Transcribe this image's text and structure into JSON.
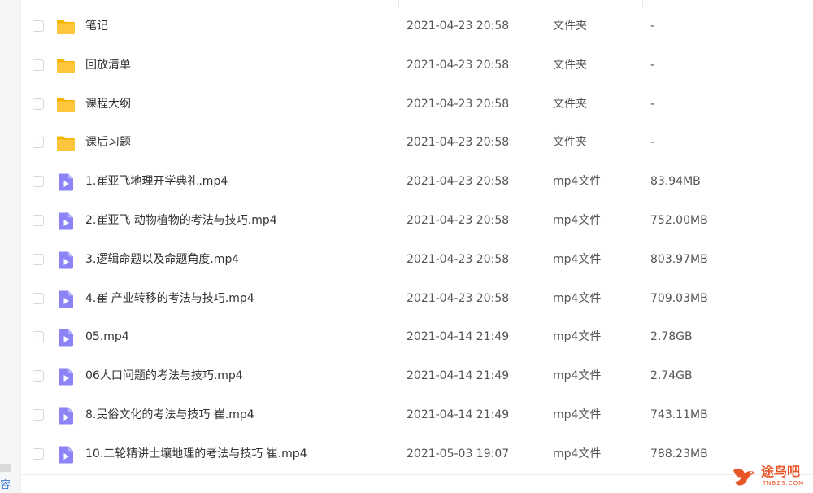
{
  "colors": {
    "folder": "#FFC53D",
    "folder_tab": "#F5B400",
    "video": "#8B83F6",
    "accent": "#3B7BD6",
    "watermark": "#E8572A"
  },
  "left_strip": {
    "text": "容"
  },
  "files": [
    {
      "name": "笔记",
      "date": "2021-04-23 20:58",
      "type": "文件夹",
      "size": "-",
      "icon": "folder-icon"
    },
    {
      "name": "回放清单",
      "date": "2021-04-23 20:58",
      "type": "文件夹",
      "size": "-",
      "icon": "folder-icon"
    },
    {
      "name": "课程大纲",
      "date": "2021-04-23 20:58",
      "type": "文件夹",
      "size": "-",
      "icon": "folder-icon"
    },
    {
      "name": "课后习题",
      "date": "2021-04-23 20:58",
      "type": "文件夹",
      "size": "-",
      "icon": "folder-icon"
    },
    {
      "name": "1.崔亚飞地理开学典礼.mp4",
      "date": "2021-04-23 20:58",
      "type": "mp4文件",
      "size": "83.94MB",
      "icon": "video-file-icon"
    },
    {
      "name": "2.崔亚飞 动物植物的考法与技巧.mp4",
      "date": "2021-04-23 20:58",
      "type": "mp4文件",
      "size": "752.00MB",
      "icon": "video-file-icon"
    },
    {
      "name": "3.逻辑命题以及命题角度.mp4",
      "date": "2021-04-23 20:58",
      "type": "mp4文件",
      "size": "803.97MB",
      "icon": "video-file-icon"
    },
    {
      "name": "4.崔 产业转移的考法与技巧.mp4",
      "date": "2021-04-23 20:58",
      "type": "mp4文件",
      "size": "709.03MB",
      "icon": "video-file-icon"
    },
    {
      "name": "05.mp4",
      "date": "2021-04-14 21:49",
      "type": "mp4文件",
      "size": "2.78GB",
      "icon": "video-file-icon"
    },
    {
      "name": "06人口问题的考法与技巧.mp4",
      "date": "2021-04-14 21:49",
      "type": "mp4文件",
      "size": "2.74GB",
      "icon": "video-file-icon"
    },
    {
      "name": "8.民俗文化的考法与技巧 崔.mp4",
      "date": "2021-04-14 21:49",
      "type": "mp4文件",
      "size": "743.11MB",
      "icon": "video-file-icon"
    },
    {
      "name": "10.二轮精讲土壤地理的考法与技巧 崔.mp4",
      "date": "2021-05-03 19:07",
      "type": "mp4文件",
      "size": "788.23MB",
      "icon": "video-file-icon"
    }
  ],
  "watermark": {
    "title": "途鸟吧",
    "sub": "TNBZS.COM"
  }
}
